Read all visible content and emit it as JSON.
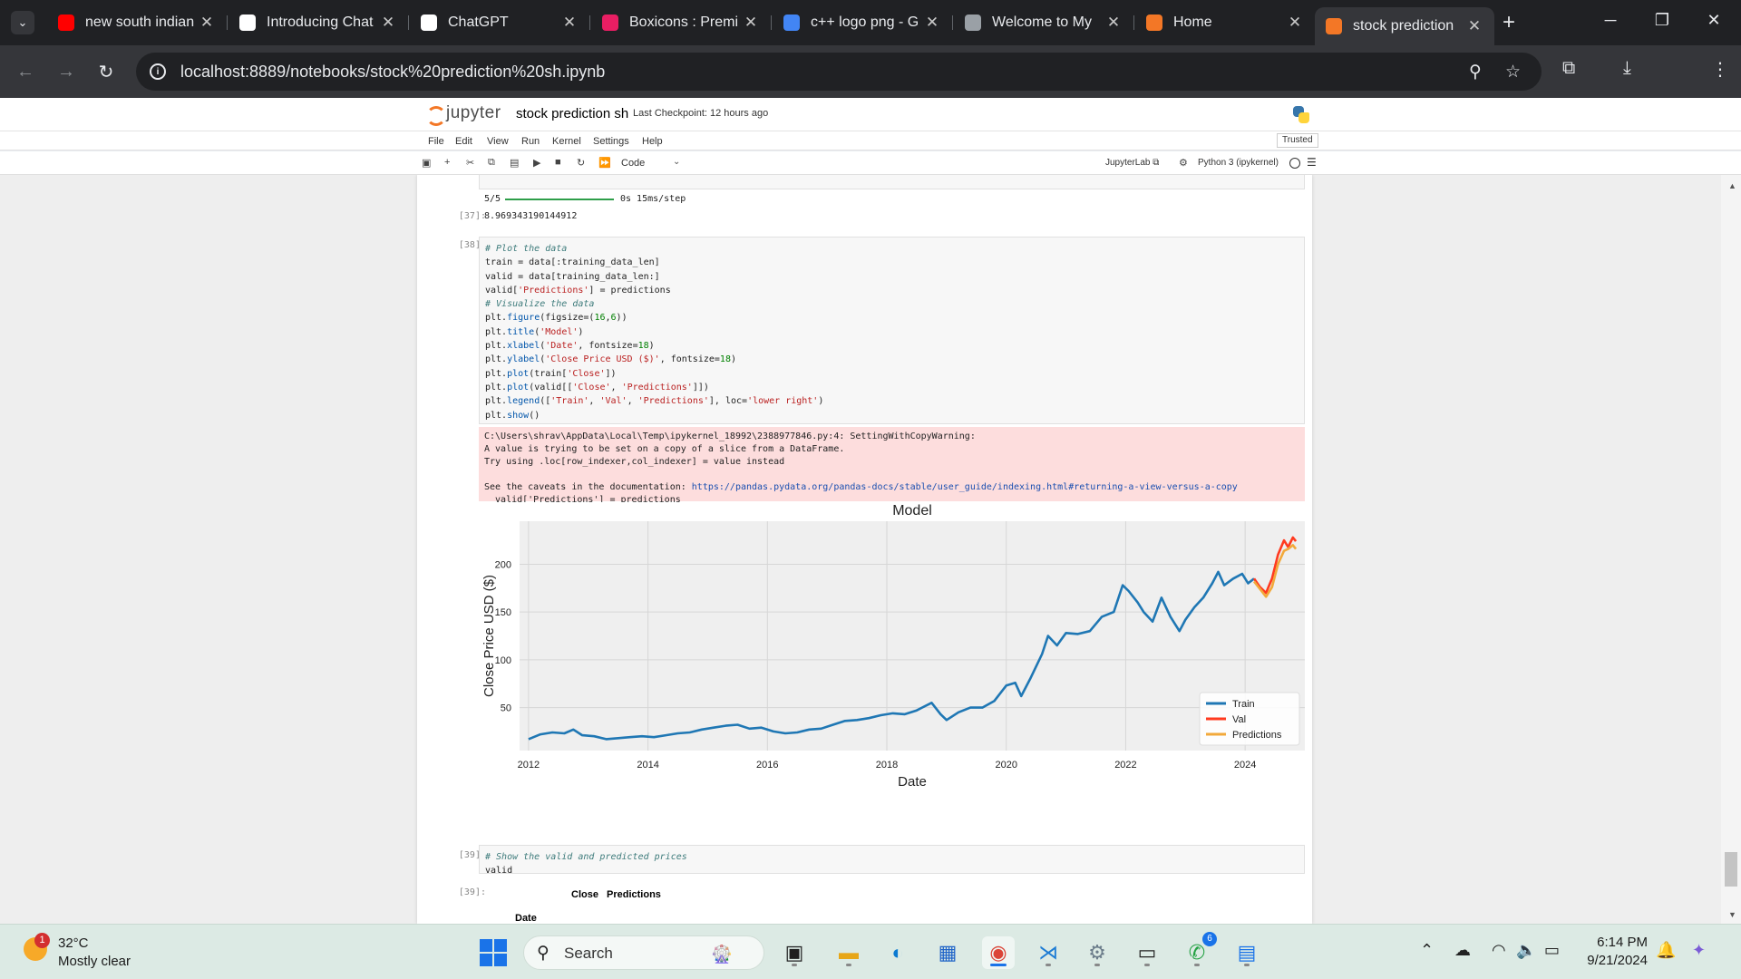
{
  "browser": {
    "tabs": [
      {
        "title": "new south indian",
        "icon": "youtube-icon",
        "color": "#ff0000"
      },
      {
        "title": "Introducing Chat",
        "icon": "openai-icon",
        "color": "#ffffff"
      },
      {
        "title": "ChatGPT",
        "icon": "openai-icon",
        "color": "#ffffff"
      },
      {
        "title": "Boxicons : Premi",
        "icon": "boxicons-icon",
        "color": "#e91e63"
      },
      {
        "title": "c++ logo png - G",
        "icon": "google-icon",
        "color": "#4285f4"
      },
      {
        "title": "Welcome to My",
        "icon": "globe-icon",
        "color": "#9aa0a6"
      },
      {
        "title": "Home",
        "icon": "jupyter-icon",
        "color": "#f37726"
      },
      {
        "title": "stock prediction",
        "icon": "jupyter-icon",
        "color": "#f37726",
        "active": true
      }
    ],
    "url": "localhost:8889/notebooks/stock%20prediction%20sh.ipynb"
  },
  "jupyter": {
    "logo_text": "jupyter",
    "notebook_name": "stock prediction sh",
    "checkpoint": "Last Checkpoint: 12 hours ago",
    "menu": [
      "File",
      "Edit",
      "View",
      "Run",
      "Kernel",
      "Settings",
      "Help"
    ],
    "trusted": "Trusted",
    "cell_type": "Code",
    "jupyterlab_link": "JupyterLab",
    "kernel": "Python 3 (ipykernel)"
  },
  "cells": {
    "progress_text": "5/5",
    "progress_suffix": "0s 15ms/step",
    "progress_fraction": 1.0,
    "prompt_37": "[37]:",
    "rmse_value": "8.969343190144912",
    "prompt_38": "[38]:",
    "code_38": [
      [
        [
          "cm",
          "# Plot the data"
        ]
      ],
      [
        [
          "",
          "train = data[:training_data_len]"
        ]
      ],
      [
        [
          "",
          "valid = data[training_data_len:]"
        ]
      ],
      [
        [
          "",
          "valid["
        ],
        [
          "st",
          "'Predictions'"
        ],
        [
          "",
          "] = predictions"
        ]
      ],
      [
        [
          "cm",
          "# Visualize the data"
        ]
      ],
      [
        [
          "",
          "plt."
        ],
        [
          "fn",
          "figure"
        ],
        [
          "",
          "(figsize=("
        ],
        [
          "nu",
          "16"
        ],
        [
          "",
          ","
        ],
        [
          "nu",
          "6"
        ],
        [
          "",
          "))"
        ]
      ],
      [
        [
          "",
          "plt."
        ],
        [
          "fn",
          "title"
        ],
        [
          "",
          "("
        ],
        [
          "st",
          "'Model'"
        ],
        [
          "",
          ")"
        ]
      ],
      [
        [
          "",
          "plt."
        ],
        [
          "fn",
          "xlabel"
        ],
        [
          "",
          "("
        ],
        [
          "st",
          "'Date'"
        ],
        [
          "",
          ", fontsize="
        ],
        [
          "nu",
          "18"
        ],
        [
          "",
          ")"
        ]
      ],
      [
        [
          "",
          "plt."
        ],
        [
          "fn",
          "ylabel"
        ],
        [
          "",
          "("
        ],
        [
          "st",
          "'Close Price USD ($)'"
        ],
        [
          "",
          ", fontsize="
        ],
        [
          "nu",
          "18"
        ],
        [
          "",
          ")"
        ]
      ],
      [
        [
          "",
          "plt."
        ],
        [
          "fn",
          "plot"
        ],
        [
          "",
          "(train["
        ],
        [
          "st",
          "'Close'"
        ],
        [
          "",
          "])"
        ]
      ],
      [
        [
          "",
          "plt."
        ],
        [
          "fn",
          "plot"
        ],
        [
          "",
          "(valid[["
        ],
        [
          "st",
          "'Close'"
        ],
        [
          "",
          ", "
        ],
        [
          "st",
          "'Predictions'"
        ],
        [
          "",
          "]])"
        ]
      ],
      [
        [
          "",
          "plt."
        ],
        [
          "fn",
          "legend"
        ],
        [
          "",
          "(["
        ],
        [
          "st",
          "'Train'"
        ],
        [
          "",
          ", "
        ],
        [
          "st",
          "'Val'"
        ],
        [
          "",
          ", "
        ],
        [
          "st",
          "'Predictions'"
        ],
        [
          "",
          "], loc="
        ],
        [
          "st",
          "'lower right'"
        ],
        [
          "",
          ")"
        ]
      ],
      [
        [
          "",
          "plt."
        ],
        [
          "fn",
          "show"
        ],
        [
          "",
          "()"
        ]
      ]
    ],
    "warning_lines": [
      "C:\\Users\\shrav\\AppData\\Local\\Temp\\ipykernel_18992\\2388977846.py:4: SettingWithCopyWarning:",
      "A value is trying to be set on a copy of a slice from a DataFrame.",
      "Try using .loc[row_indexer,col_indexer] = value instead",
      "",
      "See the caveats in the documentation: ",
      "  valid['Predictions'] = predictions"
    ],
    "warning_link": "https://pandas.pydata.org/pandas-docs/stable/user_guide/indexing.html#returning-a-view-versus-a-copy",
    "prompt_39_in": "[39]:",
    "code_39_comment": "# Show the valid and predicted prices",
    "code_39_line2": "valid",
    "prompt_39_out": "[39]:",
    "df_col_close": "Close",
    "df_col_pred": "Predictions",
    "df_index_name": "Date"
  },
  "chart_data": {
    "type": "line",
    "title": "Model",
    "xlabel": "Date",
    "ylabel": "Close Price USD ($)",
    "xlim": [
      2011.85,
      2025.0
    ],
    "ylim": [
      5,
      245
    ],
    "xticks": [
      2012,
      2014,
      2016,
      2018,
      2020,
      2022,
      2024
    ],
    "yticks": [
      50,
      100,
      150,
      200
    ],
    "grid": true,
    "legend_position": "lower-right",
    "series": [
      {
        "name": "Train",
        "color": "#1f77b4",
        "points": [
          [
            2012.0,
            17
          ],
          [
            2012.2,
            22
          ],
          [
            2012.4,
            24
          ],
          [
            2012.6,
            23
          ],
          [
            2012.75,
            27
          ],
          [
            2012.9,
            21
          ],
          [
            2013.1,
            20
          ],
          [
            2013.3,
            17
          ],
          [
            2013.5,
            18
          ],
          [
            2013.7,
            19
          ],
          [
            2013.9,
            20
          ],
          [
            2014.1,
            19
          ],
          [
            2014.3,
            21
          ],
          [
            2014.5,
            23
          ],
          [
            2014.7,
            24
          ],
          [
            2014.9,
            27
          ],
          [
            2015.1,
            29
          ],
          [
            2015.3,
            31
          ],
          [
            2015.5,
            32
          ],
          [
            2015.7,
            28
          ],
          [
            2015.9,
            29
          ],
          [
            2016.1,
            25
          ],
          [
            2016.3,
            23
          ],
          [
            2016.5,
            24
          ],
          [
            2016.7,
            27
          ],
          [
            2016.9,
            28
          ],
          [
            2017.1,
            32
          ],
          [
            2017.3,
            36
          ],
          [
            2017.5,
            37
          ],
          [
            2017.7,
            39
          ],
          [
            2017.9,
            42
          ],
          [
            2018.1,
            44
          ],
          [
            2018.3,
            43
          ],
          [
            2018.5,
            47
          ],
          [
            2018.75,
            55
          ],
          [
            2018.9,
            43
          ],
          [
            2019.0,
            37
          ],
          [
            2019.2,
            45
          ],
          [
            2019.4,
            50
          ],
          [
            2019.6,
            50
          ],
          [
            2019.8,
            57
          ],
          [
            2020.0,
            73
          ],
          [
            2020.15,
            76
          ],
          [
            2020.25,
            62
          ],
          [
            2020.4,
            80
          ],
          [
            2020.6,
            106
          ],
          [
            2020.7,
            125
          ],
          [
            2020.85,
            115
          ],
          [
            2021.0,
            128
          ],
          [
            2021.2,
            127
          ],
          [
            2021.4,
            130
          ],
          [
            2021.6,
            145
          ],
          [
            2021.8,
            150
          ],
          [
            2021.95,
            178
          ],
          [
            2022.05,
            172
          ],
          [
            2022.2,
            160
          ],
          [
            2022.3,
            150
          ],
          [
            2022.45,
            140
          ],
          [
            2022.6,
            165
          ],
          [
            2022.75,
            145
          ],
          [
            2022.9,
            130
          ],
          [
            2023.0,
            142
          ],
          [
            2023.15,
            155
          ],
          [
            2023.3,
            165
          ],
          [
            2023.45,
            180
          ],
          [
            2023.55,
            192
          ],
          [
            2023.65,
            178
          ],
          [
            2023.8,
            185
          ],
          [
            2023.95,
            190
          ],
          [
            2024.05,
            180
          ],
          [
            2024.15,
            185
          ]
        ]
      },
      {
        "name": "Val",
        "color": "#ff3a1f",
        "points": [
          [
            2024.15,
            185
          ],
          [
            2024.25,
            176
          ],
          [
            2024.35,
            170
          ],
          [
            2024.45,
            185
          ],
          [
            2024.55,
            210
          ],
          [
            2024.65,
            225
          ],
          [
            2024.72,
            218
          ],
          [
            2024.8,
            228
          ],
          [
            2024.85,
            224
          ]
        ]
      },
      {
        "name": "Predictions",
        "color": "#f2a93b",
        "points": [
          [
            2024.15,
            182
          ],
          [
            2024.25,
            174
          ],
          [
            2024.35,
            166
          ],
          [
            2024.45,
            176
          ],
          [
            2024.55,
            200
          ],
          [
            2024.65,
            214
          ],
          [
            2024.72,
            216
          ],
          [
            2024.8,
            220
          ],
          [
            2024.85,
            216
          ]
        ]
      }
    ]
  },
  "taskbar": {
    "weather_temp": "32°C",
    "weather_cond": "Mostly clear",
    "weather_badge": "1",
    "search_label": "Search",
    "whatsapp_badge": "6",
    "time": "6:14 PM",
    "date": "9/21/2024"
  }
}
